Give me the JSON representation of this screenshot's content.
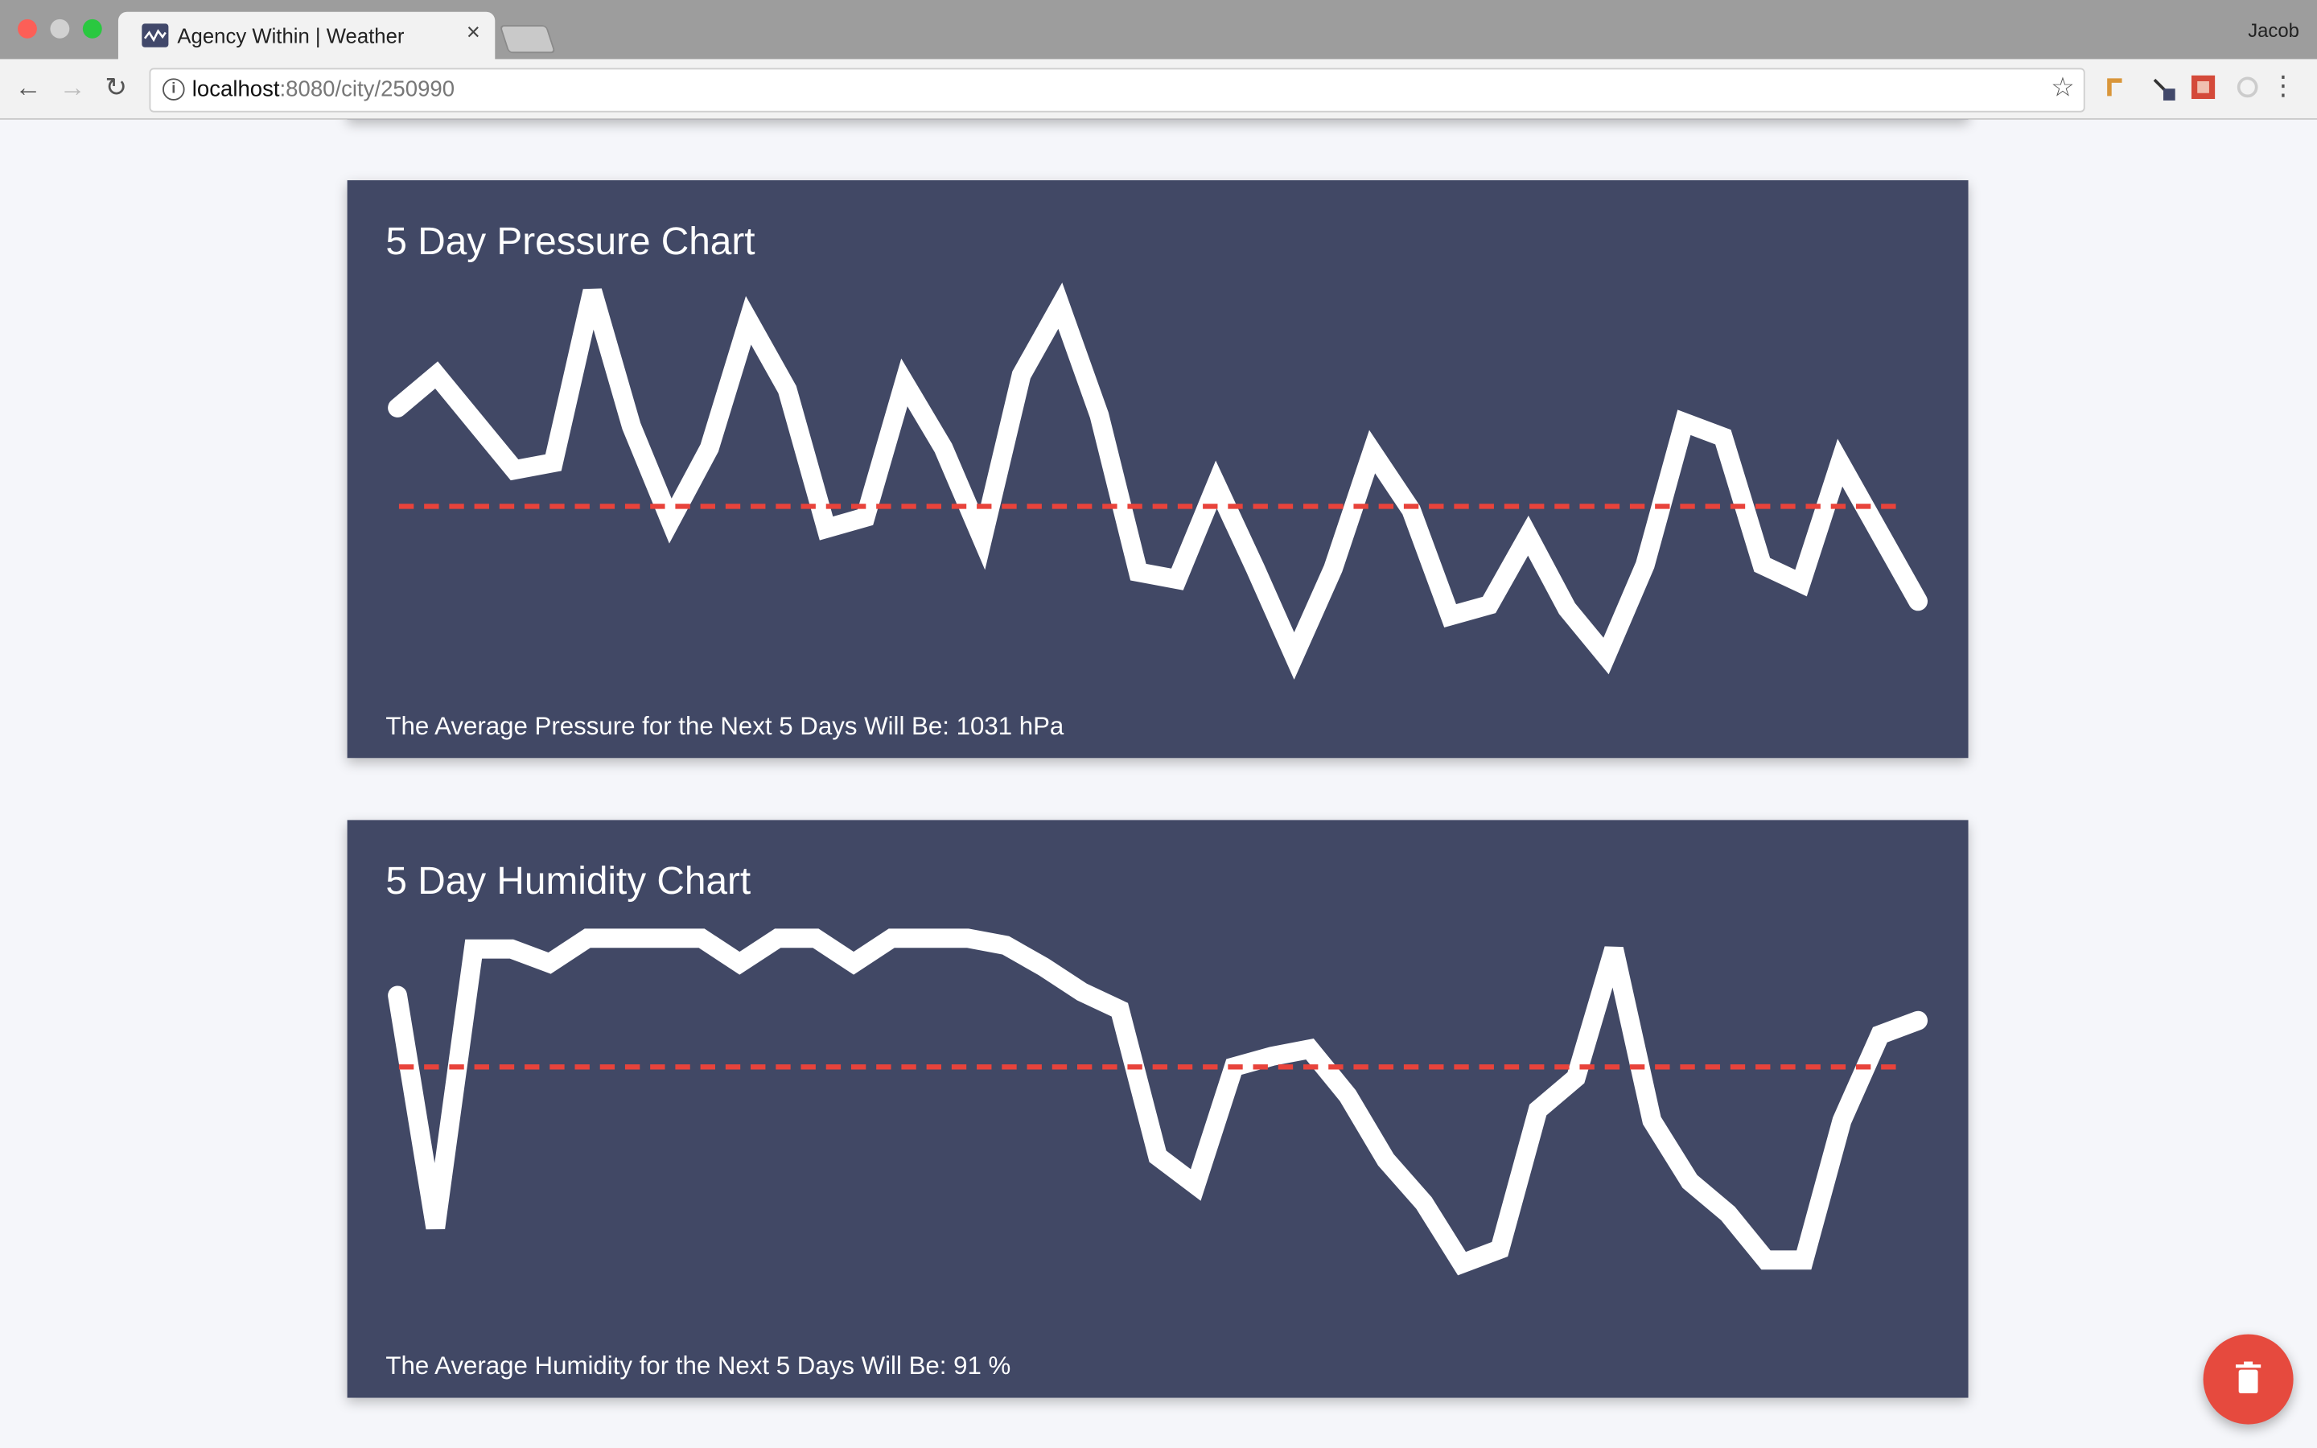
{
  "browser": {
    "tab_title": "Agency Within | Weather",
    "tab_close": "×",
    "profile_name": "Jacob",
    "url_host": "localhost",
    "url_path": ":8080/city/250990"
  },
  "pressure_card": {
    "title": "5 Day Pressure Chart",
    "summary": "The Average Pressure for the Next 5 Days Will Be: 1031 hPa"
  },
  "humidity_card": {
    "title": "5 Day Humidity Chart",
    "summary": "The Average Humidity for the Next 5 Days Will Be: 91 %"
  },
  "colors": {
    "card_bg": "#414865",
    "line": "#ffffff",
    "average_line": "#e8433b",
    "fab": "#e64a3e",
    "page_bg": "#f5f6fa"
  },
  "icons": {
    "fab": "trash-icon"
  },
  "chart_data": [
    {
      "type": "line",
      "title": "5 Day Pressure Chart",
      "unit": "hPa",
      "average": 1031,
      "y_relative": [
        0.68,
        0.77,
        0.64,
        0.51,
        0.53,
        1.0,
        0.63,
        0.37,
        0.57,
        0.92,
        0.73,
        0.35,
        0.38,
        0.75,
        0.57,
        0.32,
        0.77,
        0.96,
        0.66,
        0.23,
        0.21,
        0.47,
        0.24,
        0.0,
        0.24,
        0.56,
        0.4,
        0.11,
        0.14,
        0.33,
        0.13,
        0.0,
        0.25,
        0.64,
        0.6,
        0.25,
        0.2,
        0.53,
        0.34,
        0.15
      ],
      "average_relative": 0.41
    },
    {
      "type": "line",
      "title": "5 Day Humidity Chart",
      "unit": "%",
      "average": 91,
      "y_relative": [
        0.84,
        0.19,
        0.97,
        0.97,
        0.93,
        1.0,
        1.0,
        1.0,
        1.0,
        0.93,
        1.0,
        1.0,
        0.93,
        1.0,
        1.0,
        1.0,
        0.98,
        0.92,
        0.85,
        0.8,
        0.39,
        0.31,
        0.64,
        0.67,
        0.69,
        0.56,
        0.38,
        0.26,
        0.09,
        0.13,
        0.52,
        0.61,
        0.97,
        0.49,
        0.32,
        0.23,
        0.1,
        0.1,
        0.49,
        0.73,
        0.77
      ],
      "average_relative": 0.64
    }
  ]
}
